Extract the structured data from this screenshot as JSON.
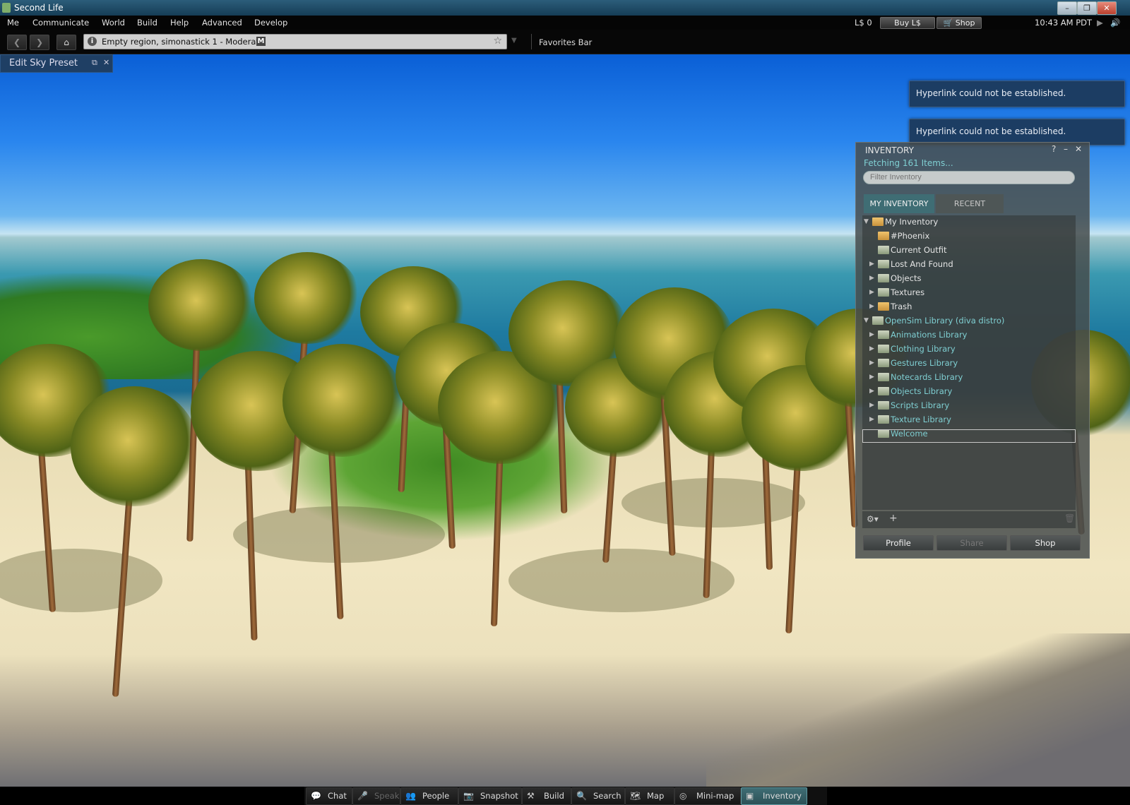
{
  "window": {
    "title": "Second Life"
  },
  "menu": {
    "items": [
      "Me",
      "Communicate",
      "World",
      "Build",
      "Help",
      "Advanced",
      "Develop"
    ],
    "balance": "L$ 0",
    "buy_label": "Buy L$",
    "shop_label": "Shop",
    "time": "10:43 AM PDT"
  },
  "nav": {
    "location": "Empty region, simonastick 1 - Moderate",
    "maturity_badge": "M",
    "favorites": "Favorites Bar"
  },
  "sky_preset": {
    "label": "Edit Sky Preset"
  },
  "toasts": [
    "Hyperlink could not be established.",
    "Hyperlink could not be established."
  ],
  "inventory": {
    "title": "INVENTORY",
    "status": "Fetching 161 Items...",
    "filter_placeholder": "Filter Inventory",
    "tabs": [
      "MY INVENTORY",
      "RECENT"
    ],
    "items": [
      {
        "label": "My Inventory",
        "expander": "open",
        "level": 0
      },
      {
        "label": "#Phoenix",
        "expander": "none",
        "level": 1
      },
      {
        "label": "Current Outfit",
        "expander": "none",
        "level": 1
      },
      {
        "label": "Lost And Found",
        "expander": "closed",
        "level": 1
      },
      {
        "label": "Objects",
        "expander": "closed",
        "level": 1
      },
      {
        "label": "Textures",
        "expander": "closed",
        "level": 1
      },
      {
        "label": "Trash",
        "expander": "closed",
        "level": 1
      },
      {
        "label": "OpenSim Library (diva distro)",
        "expander": "open",
        "level": 0
      },
      {
        "label": "Animations Library",
        "expander": "closed",
        "level": 1
      },
      {
        "label": "Clothing Library",
        "expander": "closed",
        "level": 1
      },
      {
        "label": "Gestures Library",
        "expander": "closed",
        "level": 1
      },
      {
        "label": "Notecards Library",
        "expander": "closed",
        "level": 1
      },
      {
        "label": "Objects Library",
        "expander": "closed",
        "level": 1
      },
      {
        "label": "Scripts Library",
        "expander": "closed",
        "level": 1
      },
      {
        "label": "Texture Library",
        "expander": "closed",
        "level": 1
      },
      {
        "label": "Welcome",
        "expander": "none",
        "level": 1
      }
    ],
    "buttons": [
      "Profile",
      "Share",
      "Shop"
    ],
    "library_color": "#7fcfd2"
  },
  "toolbar": {
    "buttons": [
      {
        "label": "Chat",
        "icon": "chat-icon",
        "glyph": "💬"
      },
      {
        "label": "Speak",
        "icon": "microphone-icon",
        "glyph": "🎤"
      },
      {
        "label": "People",
        "icon": "people-icon",
        "glyph": "👥"
      },
      {
        "label": "Snapshot",
        "icon": "camera-icon",
        "glyph": "📷"
      },
      {
        "label": "Build",
        "icon": "hammer-icon",
        "glyph": "⚒"
      },
      {
        "label": "Search",
        "icon": "search-icon",
        "glyph": "🔍"
      },
      {
        "label": "Map",
        "icon": "map-icon",
        "glyph": "🗺"
      },
      {
        "label": "Mini-map",
        "icon": "radar-icon",
        "glyph": "◎"
      },
      {
        "label": "Inventory",
        "icon": "inventory-icon",
        "glyph": "▣"
      }
    ]
  }
}
